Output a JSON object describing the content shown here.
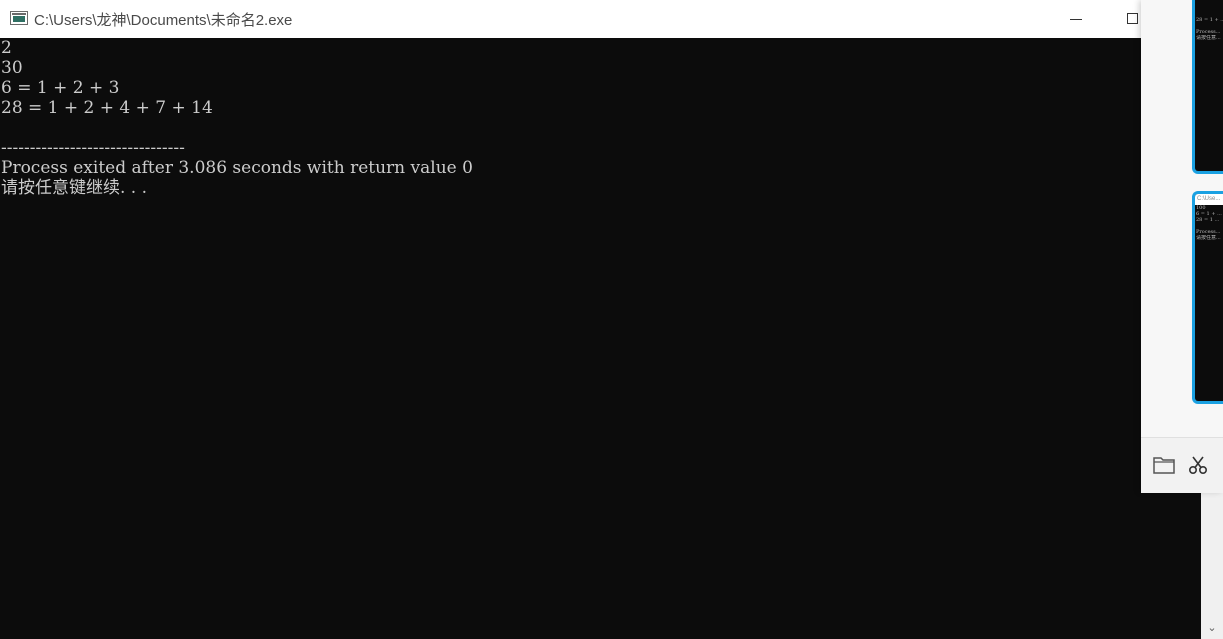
{
  "window": {
    "title": "C:\\Users\\龙神\\Documents\\未命名2.exe"
  },
  "console": {
    "lines": [
      "2",
      "30",
      "6 = 1 + 2 + 3",
      "28 = 1 + 2 + 4 + 7 + 14",
      "",
      "--------------------------------",
      "Process exited after 3.086 seconds with return value 0",
      "请按任意键继续. . ."
    ]
  },
  "side_panel": {
    "thumb1_lines": [
      "28 = 1 + ...",
      "",
      "Process...",
      "请按任意..."
    ],
    "thumb2_title": "C:\\Use...",
    "thumb2_lines": [
      "100",
      "6 = 1 + ...",
      "28 = 1 ...",
      "",
      "Process...",
      "请按任意..."
    ],
    "icons": [
      "folder-icon",
      "scissors-icon"
    ]
  },
  "colors": {
    "console_bg": "#0c0c0c",
    "console_text": "#cccccc",
    "accent": "#1ba1e2"
  }
}
